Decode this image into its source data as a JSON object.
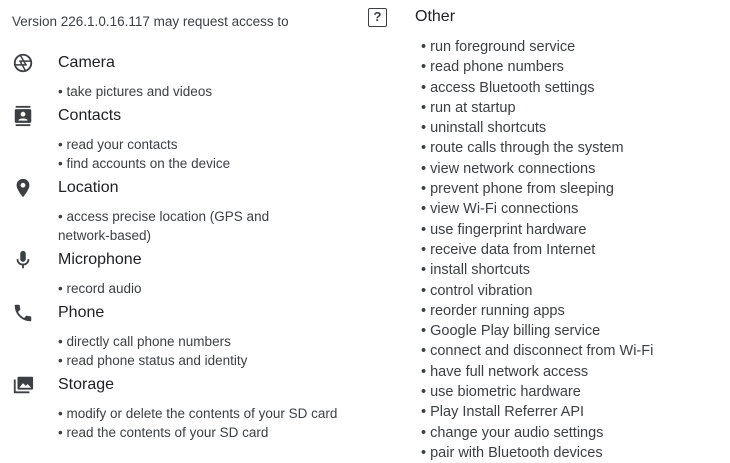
{
  "header": {
    "version_text": "Version 226.1.0.16.117 may request access to"
  },
  "groups": [
    {
      "title": "Camera",
      "icon": "camera-icon",
      "items": [
        "take pictures and videos"
      ]
    },
    {
      "title": "Contacts",
      "icon": "contacts-icon",
      "items": [
        "read your contacts",
        "find accounts on the device"
      ]
    },
    {
      "title": "Location",
      "icon": "location-pin-icon",
      "items": [
        "access precise location (GPS and network-based)"
      ]
    },
    {
      "title": "Microphone",
      "icon": "microphone-icon",
      "items": [
        "record audio"
      ]
    },
    {
      "title": "Phone",
      "icon": "phone-icon",
      "items": [
        "directly call phone numbers",
        "read phone status and identity"
      ]
    },
    {
      "title": "Storage",
      "icon": "storage-image-icon",
      "items": [
        "modify or delete the contents of your SD card",
        "read the contents of your SD card"
      ]
    }
  ],
  "other": {
    "title": "Other",
    "icon": "question-box-icon",
    "icon_glyph": "?",
    "items": [
      "run foreground service",
      "read phone numbers",
      "access Bluetooth settings",
      "run at startup",
      "uninstall shortcuts",
      "route calls through the system",
      "view network connections",
      "prevent phone from sleeping",
      "view Wi-Fi connections",
      "use fingerprint hardware",
      "receive data from Internet",
      "install shortcuts",
      "control vibration",
      "reorder running apps",
      "Google Play billing service",
      "connect and disconnect from Wi-Fi",
      "have full network access",
      "use biometric hardware",
      "Play Install Referrer API",
      "change your audio settings",
      "pair with Bluetooth devices"
    ]
  }
}
